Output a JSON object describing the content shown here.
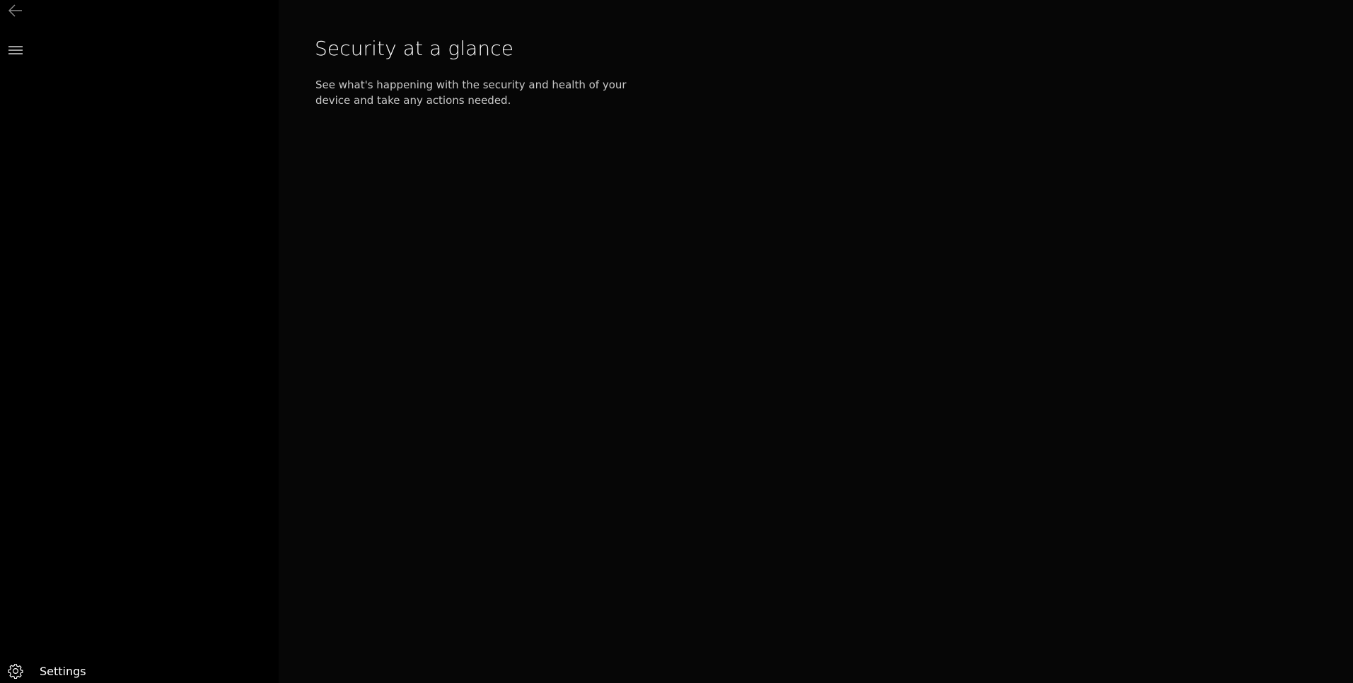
{
  "navigation": {
    "back_icon": "back-arrow-icon",
    "menu_icon": "hamburger-menu-icon"
  },
  "sidebar": {
    "settings": {
      "label": "Settings",
      "icon": "gear-icon"
    }
  },
  "main": {
    "title": "Security at a glance",
    "description": "See what's happening with the security and health of your device and take any actions needed."
  },
  "colors": {
    "sidebar_bg": "#000000",
    "main_bg": "#060606",
    "title_text": "#ffffff",
    "description_text": "#c9c9c9",
    "back_icon": "#8a8a8a"
  }
}
